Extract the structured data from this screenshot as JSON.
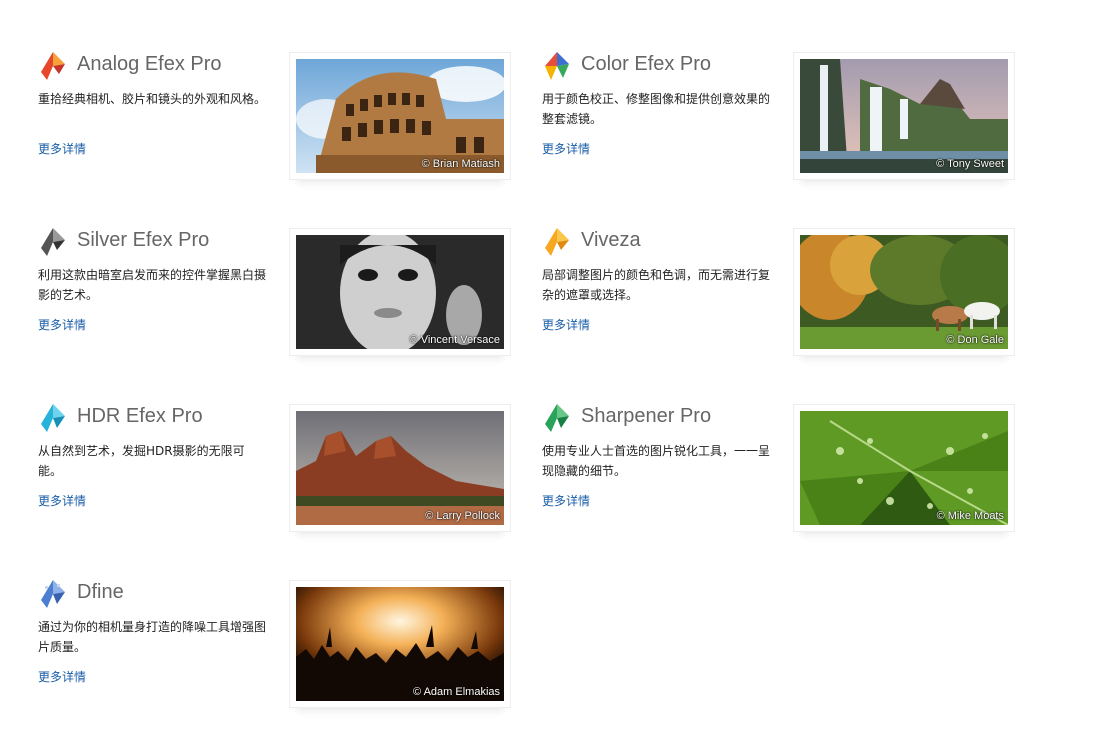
{
  "products": [
    {
      "id": "analog",
      "name": "Analog Efex Pro",
      "description": "重拾经典相机、胶片和镜头的外观和风格。",
      "more": "更多详情",
      "credit": "© Brian Matiash",
      "logo_colors": [
        "#e8462a",
        "#f7a13a",
        "#c7352a"
      ],
      "photo": "colosseum"
    },
    {
      "id": "color",
      "name": "Color Efex Pro",
      "description": "用于颜色校正、修整图像和提供创意效果的整套滤镜。",
      "more": "更多详情",
      "credit": "© Tony Sweet",
      "logo_colors": [
        "#3b6fd1",
        "#e84c3a",
        "#38a85a",
        "#f4b400"
      ],
      "photo": "waterfall"
    },
    {
      "id": "silver",
      "name": "Silver Efex Pro",
      "description": "利用这款由暗室启发而来的控件掌握黑白摄影的艺术。",
      "more": "更多详情",
      "credit": "© Vincent Versace",
      "logo_colors": [
        "#555555",
        "#999999",
        "#333333"
      ],
      "photo": "portrait"
    },
    {
      "id": "viveza",
      "name": "Viveza",
      "description": "局部调整图片的颜色和色调，而无需进行复杂的遮罩或选择。",
      "more": "更多详情",
      "credit": "© Don Gale",
      "logo_colors": [
        "#f6a821",
        "#f9c84a",
        "#e08a14"
      ],
      "photo": "horses"
    },
    {
      "id": "hdr",
      "name": "HDR Efex Pro",
      "description": "从自然到艺术，发掘HDR摄影的无限可能。",
      "more": "更多详情",
      "credit": "© Larry Pollock",
      "logo_colors": [
        "#27b3d9",
        "#6fd3ee",
        "#1590b8"
      ],
      "photo": "redrocks"
    },
    {
      "id": "sharpener",
      "name": "Sharpener Pro",
      "description": "使用专业人士首选的图片锐化工具，一一呈现隐藏的细节。",
      "more": "更多详情",
      "credit": "© Mike Moats",
      "logo_colors": [
        "#2aa35a",
        "#68c686",
        "#178043"
      ],
      "photo": "leaf"
    },
    {
      "id": "dfine",
      "name": "Dfine",
      "description": "通过为你的相机量身打造的降噪工具增强图片质量。",
      "more": "更多详情",
      "credit": "© Adam Elmakias",
      "logo_colors": [
        "#4d7fd0",
        "#8fb1e8",
        "#3762b0"
      ],
      "photo": "concert"
    }
  ]
}
